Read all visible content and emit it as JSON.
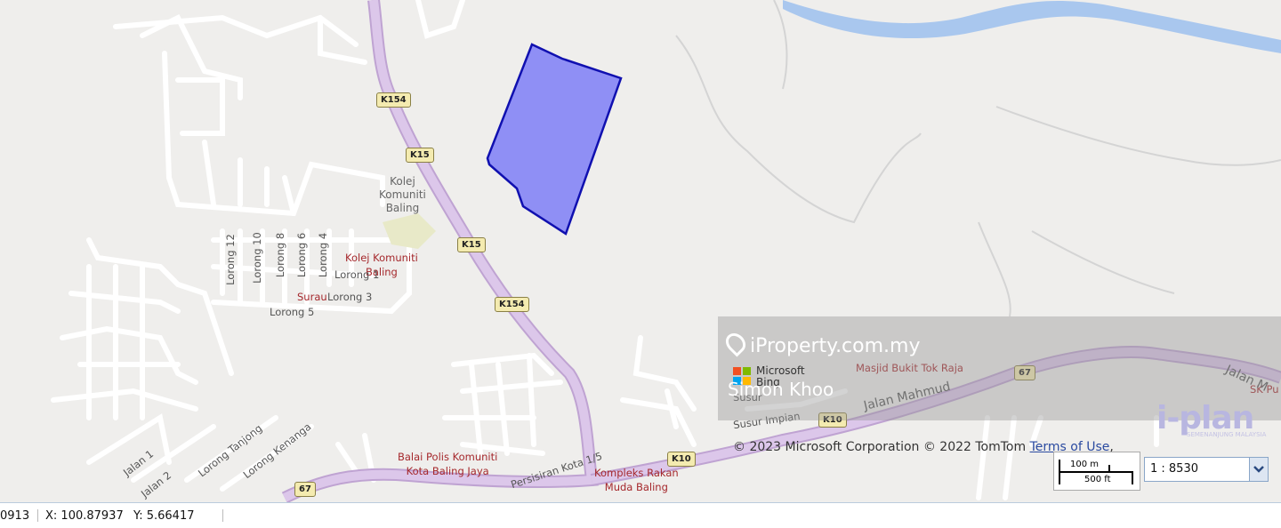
{
  "map": {
    "route_shields": [
      "K154",
      "K15",
      "K15",
      "K154",
      "67",
      "K10",
      "K10",
      "67"
    ],
    "places": {
      "kolej_gray": [
        "Kolej",
        "Komuniti",
        "Baling"
      ],
      "kolej_poi": [
        "Kolej Komuniti",
        "Baling"
      ],
      "surau": "Surau",
      "masjid": "Masjid Bukit Tok Raja",
      "balai_polis": [
        "Balai Polis Komuniti",
        "Kota Baling Jaya"
      ],
      "kompleks": [
        "Kompleks Rakan",
        "Muda Baling"
      ],
      "sk": "SK Pu"
    },
    "streets": {
      "lorong12": "Lorong 12",
      "lorong10": "Lorong 10",
      "lorong8": "Lorong 8",
      "lorong6": "Lorong 6",
      "lorong4": "Lorong 4",
      "lorong1": "Lorong 1",
      "lorong3": "Lorong 3",
      "lorong5": "Lorong 5",
      "jalan1": "Jalan 1",
      "jalan2": "Jalan 2",
      "tanjong": "Lorong Tanjong",
      "kenanga": "Lorong Kenanga",
      "persisiran": "Persisiran Kota 1/5",
      "susur": "Susur",
      "susur_impian": "Susur Impian",
      "jalan_mahmud": "Jalan Mahmud",
      "jalan_m": "Jalan M"
    },
    "overlay_colors": {
      "parcel_fill": "#8f8ff5",
      "parcel_stroke": "#1010b0",
      "highway": "#d9c3e6"
    }
  },
  "watermark": {
    "site": "iProperty.com.my",
    "bing_line1": "Microsoft",
    "bing_line2": "Bing",
    "agent": "Simon Khoo"
  },
  "attribution": {
    "text": "© 2023 Microsoft Corporation © 2022 TomTom",
    "link": "Terms of Use",
    "trailing": ","
  },
  "scale": {
    "metric": "100 m",
    "imperial": "500 ft",
    "ratio": "1 : 8530"
  },
  "iplan": {
    "brand": "i-plan",
    "tagline": "SEMENANJUNG MALAYSIA"
  },
  "status": {
    "left": "0913",
    "x": "X: 100.87937",
    "y": "Y: 5.66417"
  }
}
